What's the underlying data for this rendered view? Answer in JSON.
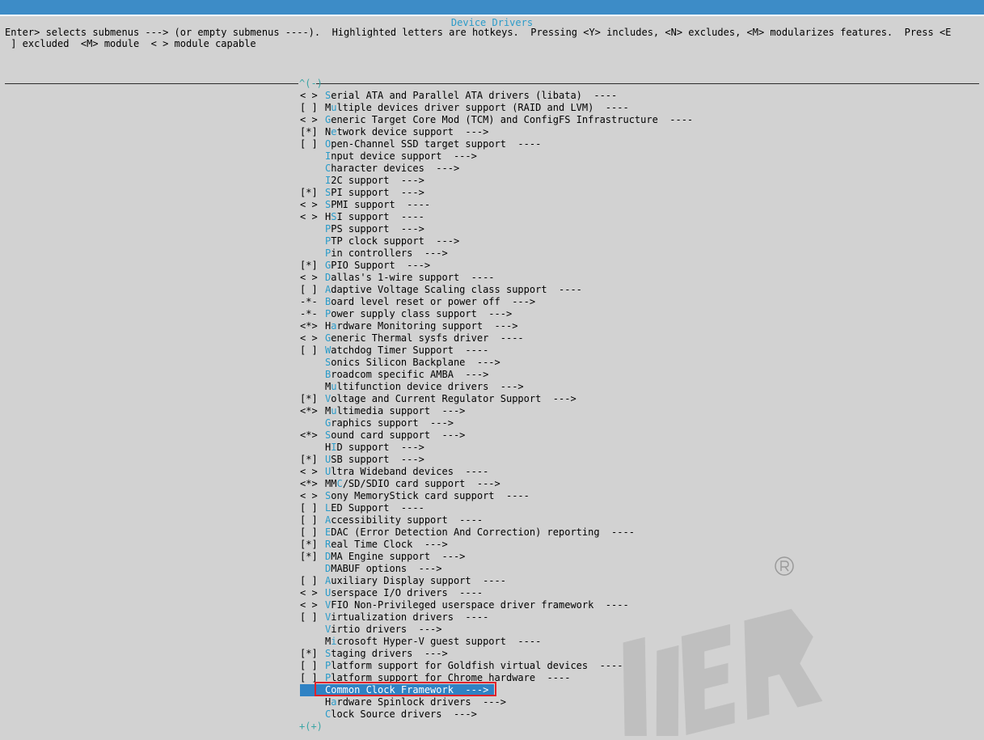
{
  "window": {
    "title": "Device Drivers",
    "help_line_1": "Enter> selects submenus ---> (or empty submenus ----).  Highlighted letters are hotkeys.  Pressing <Y> includes, <N> excludes, <M> modularizes features.  Press <E",
    "help_line_2": " ] excluded  <M> module  < > module capable"
  },
  "scroll": {
    "up_indicator": "^(-)",
    "down_indicator": "+(+)"
  },
  "colors": {
    "title_bar": "#3d8cc7",
    "hotkey": "#2a9bc9",
    "selected_bg": "#2f82c4",
    "highlight_box": "#e0222a"
  },
  "menu": {
    "items": [
      {
        "mark": "< >",
        "hotkey": "S",
        "rest": "erial ATA and Parallel ATA drivers (libata)  ----"
      },
      {
        "mark": "[ ]",
        "hotkey": "",
        "pre": "M",
        "hk2": "u",
        "rest": "ltiple devices driver support (RAID and LVM)  ----"
      },
      {
        "mark": "< >",
        "hotkey": "G",
        "rest": "eneric Target Core Mod (TCM) and ConfigFS Infrastructure  ----"
      },
      {
        "mark": "[*]",
        "hotkey": "",
        "pre": "N",
        "hk2": "e",
        "rest": "twork device support  --->"
      },
      {
        "mark": "[ ]",
        "hotkey": "O",
        "rest": "pen-Channel SSD target support  ----"
      },
      {
        "mark": "",
        "hotkey": "I",
        "rest": "nput device support  --->"
      },
      {
        "mark": "",
        "hotkey": "C",
        "rest": "haracter devices  --->"
      },
      {
        "mark": "",
        "hotkey": "I",
        "rest": "2C support  --->"
      },
      {
        "mark": "[*]",
        "hotkey": "S",
        "rest": "PI support  --->"
      },
      {
        "mark": "< >",
        "hotkey": "S",
        "rest": "PMI support  ----"
      },
      {
        "mark": "< >",
        "hotkey": "",
        "pre": "H",
        "hk2": "S",
        "rest": "I support  ----"
      },
      {
        "mark": "",
        "hotkey": "P",
        "rest": "PS support  --->"
      },
      {
        "mark": "",
        "hotkey": "P",
        "rest": "TP clock support  --->"
      },
      {
        "mark": "",
        "hotkey": "P",
        "rest": "in controllers  --->"
      },
      {
        "mark": "[*]",
        "hotkey": "G",
        "rest": "PIO Support  --->"
      },
      {
        "mark": "< >",
        "hotkey": "D",
        "rest": "allas's 1-wire support  ----"
      },
      {
        "mark": "[ ]",
        "hotkey": "A",
        "rest": "daptive Voltage Scaling class support  ----"
      },
      {
        "mark": "-*-",
        "hotkey": "B",
        "rest": "oard level reset or power off  --->"
      },
      {
        "mark": "-*-",
        "hotkey": "P",
        "rest": "ower supply class support  --->"
      },
      {
        "mark": "<*>",
        "hotkey": "",
        "pre": "H",
        "hk2": "a",
        "rest": "rdware Monitoring support  --->"
      },
      {
        "mark": "< >",
        "hotkey": "G",
        "rest": "eneric Thermal sysfs driver  ----"
      },
      {
        "mark": "[ ]",
        "hotkey": "W",
        "rest": "atchdog Timer Support  ----"
      },
      {
        "mark": "",
        "hotkey": "S",
        "rest": "onics Silicon Backplane  --->"
      },
      {
        "mark": "",
        "hotkey": "B",
        "rest": "roadcom specific AMBA  --->"
      },
      {
        "mark": "",
        "hotkey": "",
        "pre": "M",
        "hk2": "u",
        "rest": "ltifunction device drivers  --->"
      },
      {
        "mark": "[*]",
        "hotkey": "V",
        "rest": "oltage and Current Regulator Support  --->"
      },
      {
        "mark": "<*>",
        "hotkey": "",
        "pre": "M",
        "hk2": "u",
        "rest": "ltimedia support  --->"
      },
      {
        "mark": "",
        "hotkey": "G",
        "rest": "raphics support  --->"
      },
      {
        "mark": "<*>",
        "hotkey": "S",
        "rest": "ound card support  --->"
      },
      {
        "mark": "",
        "hotkey": "",
        "pre": "H",
        "hk2": "I",
        "rest": "D support  --->"
      },
      {
        "mark": "[*]",
        "hotkey": "U",
        "rest": "SB support  --->"
      },
      {
        "mark": "< >",
        "hotkey": "U",
        "rest": "ltra Wideband devices  ----"
      },
      {
        "mark": "<*>",
        "hotkey": "",
        "pre": "MM",
        "hk2": "C",
        "rest": "/SD/SDIO card support  --->"
      },
      {
        "mark": "< >",
        "hotkey": "S",
        "rest": "ony MemoryStick card support  ----"
      },
      {
        "mark": "[ ]",
        "hotkey": "L",
        "rest": "ED Support  ----"
      },
      {
        "mark": "[ ]",
        "hotkey": "A",
        "rest": "ccessibility support  ----"
      },
      {
        "mark": "[ ]",
        "hotkey": "E",
        "rest": "DAC (Error Detection And Correction) reporting  ----"
      },
      {
        "mark": "[*]",
        "hotkey": "R",
        "rest": "eal Time Clock  --->"
      },
      {
        "mark": "[*]",
        "hotkey": "D",
        "rest": "MA Engine support  --->"
      },
      {
        "mark": "",
        "hotkey": "D",
        "rest": "MABUF options  --->"
      },
      {
        "mark": "[ ]",
        "hotkey": "A",
        "rest": "uxiliary Display support  ----"
      },
      {
        "mark": "< >",
        "hotkey": "U",
        "rest": "serspace I/O drivers  ----"
      },
      {
        "mark": "< >",
        "hotkey": "V",
        "rest": "FIO Non-Privileged userspace driver framework  ----"
      },
      {
        "mark": "[ ]",
        "hotkey": "V",
        "rest": "irtualization drivers  ----"
      },
      {
        "mark": "",
        "hotkey": "V",
        "rest": "irtio drivers  --->"
      },
      {
        "mark": "",
        "hotkey": "",
        "pre": "M",
        "hk2": "i",
        "rest": "crosoft Hyper-V guest support  ----"
      },
      {
        "mark": "[*]",
        "hotkey": "S",
        "rest": "taging drivers  --->"
      },
      {
        "mark": "[ ]",
        "hotkey": "P",
        "rest": "latform support for Goldfish virtual devices  ----"
      },
      {
        "mark": "[ ]",
        "hotkey": "P",
        "rest": "latform support for Chrome hardware  ----"
      },
      {
        "mark": "",
        "hotkey": "C",
        "rest": "ommon Clock Framework  --->",
        "selected": true
      },
      {
        "mark": "",
        "hotkey": "",
        "pre": "H",
        "hk2": "a",
        "rest": "rdware Spinlock drivers  --->"
      },
      {
        "mark": "",
        "hotkey": "C",
        "rest": "lock Source drivers  --->"
      }
    ]
  },
  "watermark": {
    "text": "INER",
    "registered": "®"
  }
}
